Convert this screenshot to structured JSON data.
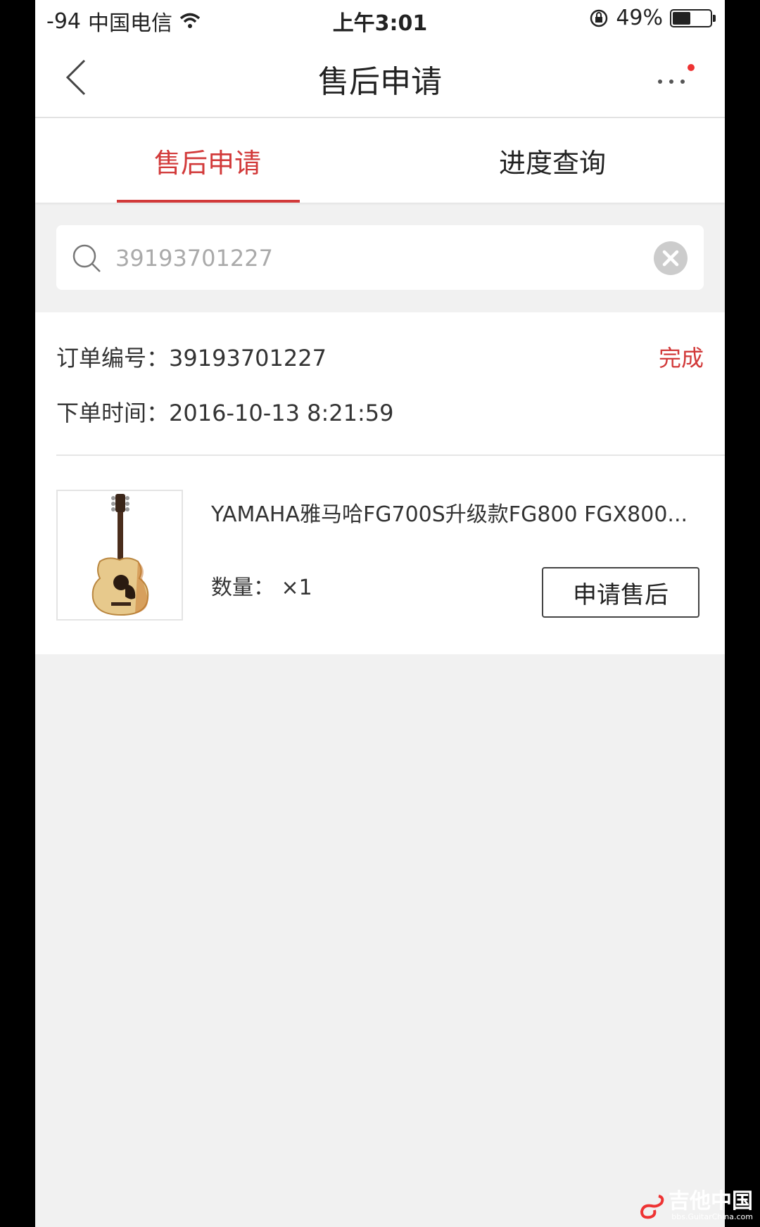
{
  "status_bar": {
    "signal": "-94",
    "carrier": "中国电信",
    "time": "上午3:01",
    "battery_percent": "49%",
    "battery_level": 0.49
  },
  "nav": {
    "title": "售后申请"
  },
  "tabs": [
    {
      "label": "售后申请",
      "active": true
    },
    {
      "label": "进度查询",
      "active": false
    }
  ],
  "search": {
    "value": "39193701227"
  },
  "order": {
    "number_label": "订单编号：",
    "number": "39193701227",
    "time_label": "下单时间：",
    "time": "2016-10-13 8:21:59",
    "status": "完成",
    "product": {
      "title": "YAMAHA雅马哈FG700S升级款FG800 FGX800...",
      "quantity_label": "数量：",
      "quantity": "×1"
    },
    "apply_button_label": "申请售后"
  },
  "watermark": {
    "text": "吉他中国",
    "sub": "bbs.GuitarChina.com"
  },
  "colors": {
    "accent": "#d23a3a",
    "background": "#f1f1f1"
  },
  "icons": [
    "back-icon",
    "more-icon",
    "search-icon",
    "clear-icon",
    "wifi-icon",
    "rotation-lock-icon",
    "battery-icon"
  ]
}
